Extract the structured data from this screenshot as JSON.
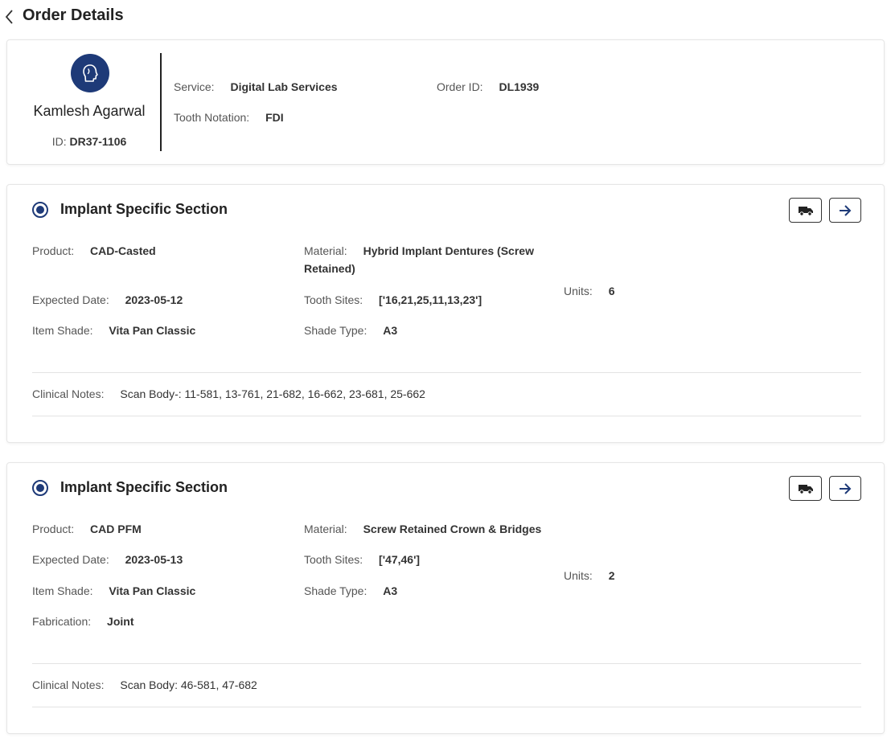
{
  "header": {
    "title": "Order Details",
    "back_icon": "chevron-left-icon"
  },
  "doctor": {
    "avatar_icon": "doctor-head-icon",
    "name": "Kamlesh Agarwal",
    "id_label": "ID:",
    "id_value": "DR37-1106"
  },
  "order": {
    "service_label": "Service:",
    "service_value": "Digital Lab Services",
    "order_id_label": "Order ID:",
    "order_id_value": "DL1939",
    "notation_label": "Tooth Notation:",
    "notation_value": "FDI"
  },
  "sections": [
    {
      "title": "Implant Specific Section",
      "product_label": "Product:",
      "product_value": "CAD-Casted",
      "material_label": "Material:",
      "material_value_line1": "Hybrid Implant Dentures (Screw",
      "material_value_line2": "Retained)",
      "expected_date_label": "Expected Date:",
      "expected_date_value": "2023-05-12",
      "tooth_sites_label": "Tooth Sites:",
      "tooth_sites_value": "['16,21,25,11,13,23']",
      "units_label": "Units:",
      "units_value": "6",
      "item_shade_label": "Item Shade:",
      "item_shade_value": "Vita Pan Classic",
      "shade_type_label": "Shade Type:",
      "shade_type_value": "A3",
      "notes_label": "Clinical Notes:",
      "notes_value": "Scan Body-: 11-581, 13-761, 21-682, 16-662, 23-681, 25-662"
    },
    {
      "title": "Implant Specific Section",
      "product_label": "Product:",
      "product_value": "CAD PFM",
      "material_label": "Material:",
      "material_value": "Screw Retained Crown & Bridges",
      "expected_date_label": "Expected Date:",
      "expected_date_value": "2023-05-13",
      "tooth_sites_label": "Tooth Sites:",
      "tooth_sites_value": "['47,46']",
      "units_label": "Units:",
      "units_value": "2",
      "item_shade_label": "Item Shade:",
      "item_shade_value": "Vita Pan Classic",
      "shade_type_label": "Shade Type:",
      "shade_type_value": "A3",
      "fabrication_label": "Fabrication:",
      "fabrication_value": "Joint",
      "notes_label": "Clinical Notes:",
      "notes_value": "Scan Body: 46-581, 47-682"
    }
  ],
  "actions": {
    "truck_icon": "truck-icon",
    "arrow_icon": "arrow-right-icon"
  },
  "colors": {
    "accent": "#1e3a78"
  }
}
